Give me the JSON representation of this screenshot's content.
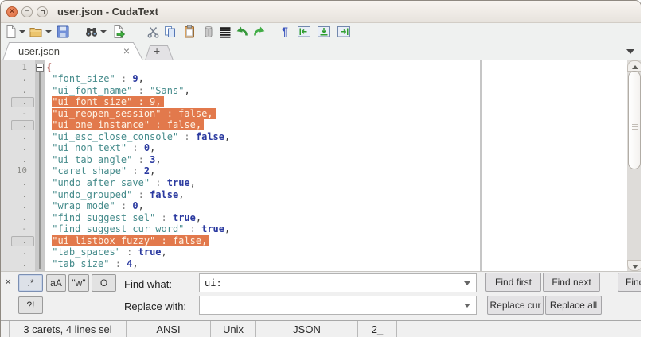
{
  "window": {
    "title": "user.json - CudaText"
  },
  "titlebar_buttons": {
    "close": "×",
    "minimize": "−",
    "maximize": ""
  },
  "toolbar": {
    "icons": [
      "new-file",
      "new-file-menu",
      "open-file",
      "open-file-menu",
      "save-file",
      "find-dialog",
      "find-menu",
      "reload-file",
      "cut",
      "copy",
      "paste",
      "delete",
      "select-all",
      "undo",
      "redo",
      "show-unprinted",
      "marker-left",
      "marker-drop",
      "marker-right"
    ],
    "glyphs": {
      "cut": "✂",
      "undo": "↶",
      "redo": "↷",
      "pilcrow": "¶"
    }
  },
  "tabs": {
    "active_label": "user.json",
    "close_glyph": "×",
    "plus_label": "+"
  },
  "editor": {
    "lines": [
      {
        "g": "1",
        "caret": false,
        "tokens": [
          [
            "br",
            "{"
          ]
        ]
      },
      {
        "g": ".",
        "caret": false,
        "tokens": [
          [
            "w",
            " "
          ],
          [
            "k",
            "\"font_size\""
          ],
          [
            "p",
            " : "
          ],
          [
            "n",
            "9"
          ],
          [
            "c",
            ","
          ]
        ]
      },
      {
        "g": ".",
        "caret": false,
        "tokens": [
          [
            "w",
            " "
          ],
          [
            "k",
            "\"ui_font_name\""
          ],
          [
            "p",
            " : "
          ],
          [
            "k",
            "\"Sans\""
          ],
          [
            "c",
            ","
          ]
        ]
      },
      {
        "g": ".",
        "caret": true,
        "tokens": [
          [
            "w",
            " "
          ],
          [
            "sel",
            "\"ui_font_size\" : 9,"
          ]
        ]
      },
      {
        "g": "-",
        "caret": false,
        "tokens": [
          [
            "w",
            " "
          ],
          [
            "sel",
            "\"ui_reopen_session\" : false,"
          ]
        ]
      },
      {
        "g": ".",
        "caret": true,
        "tokens": [
          [
            "w",
            " "
          ],
          [
            "sel",
            "\"ui_one_instance\" : false,"
          ]
        ]
      },
      {
        "g": ".",
        "caret": false,
        "tokens": [
          [
            "w",
            " "
          ],
          [
            "k",
            "\"ui_esc_close_console\""
          ],
          [
            "p",
            " : "
          ],
          [
            "n",
            "false"
          ],
          [
            "c",
            ","
          ]
        ]
      },
      {
        "g": ".",
        "caret": false,
        "tokens": [
          [
            "w",
            " "
          ],
          [
            "k",
            "\"ui_non_text\""
          ],
          [
            "p",
            " : "
          ],
          [
            "n",
            "0"
          ],
          [
            "c",
            ","
          ]
        ]
      },
      {
        "g": ".",
        "caret": false,
        "tokens": [
          [
            "w",
            " "
          ],
          [
            "k",
            "\"ui_tab_angle\""
          ],
          [
            "p",
            " : "
          ],
          [
            "n",
            "3"
          ],
          [
            "c",
            ","
          ]
        ]
      },
      {
        "g": "10",
        "caret": false,
        "tokens": [
          [
            "w",
            " "
          ],
          [
            "k",
            "\"caret_shape\""
          ],
          [
            "p",
            " : "
          ],
          [
            "n",
            "2"
          ],
          [
            "c",
            ","
          ]
        ]
      },
      {
        "g": ".",
        "caret": false,
        "tokens": [
          [
            "w",
            " "
          ],
          [
            "k",
            "\"undo_after_save\""
          ],
          [
            "p",
            " : "
          ],
          [
            "n",
            "true"
          ],
          [
            "c",
            ","
          ]
        ]
      },
      {
        "g": ".",
        "caret": false,
        "tokens": [
          [
            "w",
            " "
          ],
          [
            "k",
            "\"undo_grouped\""
          ],
          [
            "p",
            " : "
          ],
          [
            "n",
            "false"
          ],
          [
            "c",
            ","
          ]
        ]
      },
      {
        "g": ".",
        "caret": false,
        "tokens": [
          [
            "w",
            " "
          ],
          [
            "k",
            "\"wrap_mode\""
          ],
          [
            "p",
            " : "
          ],
          [
            "n",
            "0"
          ],
          [
            "c",
            ","
          ]
        ]
      },
      {
        "g": ".",
        "caret": false,
        "tokens": [
          [
            "w",
            " "
          ],
          [
            "k",
            "\"find_suggest_sel\""
          ],
          [
            "p",
            " : "
          ],
          [
            "n",
            "true"
          ],
          [
            "c",
            ","
          ]
        ]
      },
      {
        "g": "-",
        "caret": false,
        "tokens": [
          [
            "w",
            " "
          ],
          [
            "k",
            "\"find_suggest_cur_word\""
          ],
          [
            "p",
            " : "
          ],
          [
            "n",
            "true"
          ],
          [
            "c",
            ","
          ]
        ]
      },
      {
        "g": ".",
        "caret": true,
        "tokens": [
          [
            "w",
            " "
          ],
          [
            "sel",
            "\"ui_listbox_fuzzy\" : false,"
          ]
        ]
      },
      {
        "g": ".",
        "caret": false,
        "tokens": [
          [
            "w",
            " "
          ],
          [
            "k",
            "\"tab_spaces\""
          ],
          [
            "p",
            " : "
          ],
          [
            "n",
            "true"
          ],
          [
            "c",
            ","
          ]
        ]
      },
      {
        "g": ".",
        "caret": false,
        "tokens": [
          [
            "w",
            " "
          ],
          [
            "k",
            "\"tab_size\""
          ],
          [
            "p",
            " : "
          ],
          [
            "n",
            "4"
          ],
          [
            "c",
            ","
          ]
        ]
      }
    ]
  },
  "find": {
    "close_glyph": "×",
    "toggles": {
      "regex": ".*",
      "case": "aA",
      "word": "\"w\"",
      "preserve": "O",
      "confirm": "?!"
    },
    "find_label": "Find what:",
    "replace_label": "Replace with:",
    "find_value": "ui:",
    "replace_value": "",
    "buttons_row1": [
      "Find first",
      "Find next",
      "Find prev"
    ],
    "buttons_row2": [
      "Replace cur",
      "Replace all"
    ]
  },
  "statusbar": {
    "cells": [
      "3 carets, 4 lines sel",
      "ANSI",
      "Unix",
      "JSON",
      "2_",
      ""
    ]
  },
  "colors": {
    "selection": "#e2794c",
    "key": "#458b8b",
    "number": "#2b3aa0",
    "accent_close": "#dd6f43"
  }
}
